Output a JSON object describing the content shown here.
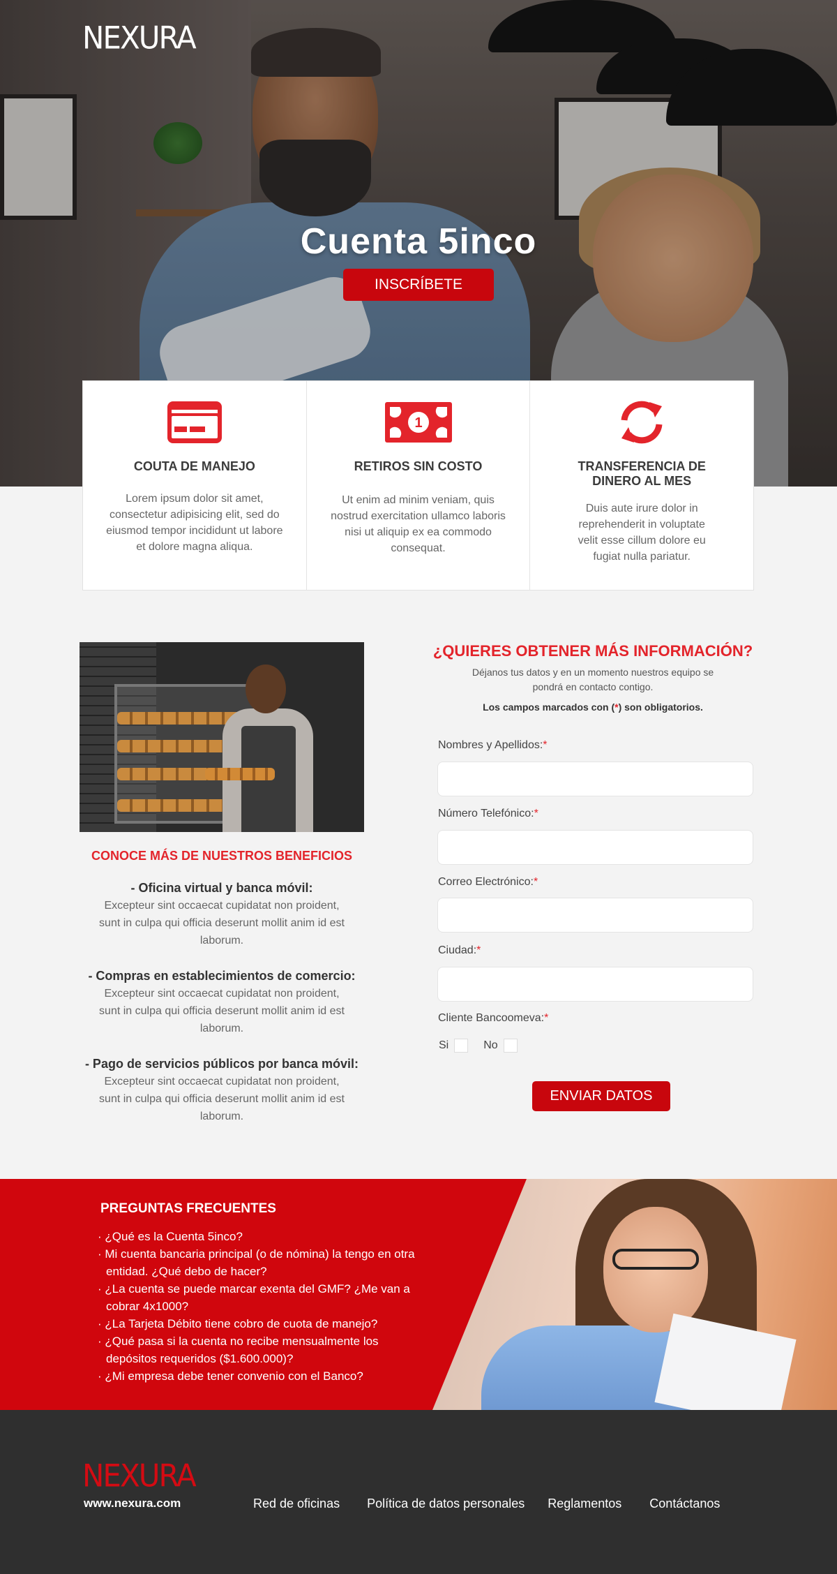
{
  "brand": {
    "logo_text": "NEXURA",
    "url_text": "www.nexura.com"
  },
  "hero": {
    "title": "Cuenta 5inco",
    "cta_label": "INSCRÍBETE"
  },
  "features": [
    {
      "icon": "credit-card-icon",
      "title": "COUTA DE MANEJO",
      "text": "Lorem ipsum dolor sit amet, consectetur adipisicing elit, sed do eiusmod tempor incididunt ut labore et dolore magna aliqua."
    },
    {
      "icon": "banknote-icon",
      "title": "RETIROS SIN COSTO",
      "text": "Ut enim ad minim veniam, quis nostrud exercitation ullamco laboris nisi ut aliquip ex ea commodo consequat."
    },
    {
      "icon": "refresh-icon",
      "title_line1": "TRANSFERENCIA DE",
      "title_line2": "DINERO AL MES",
      "text": "Duis aute irure dolor in reprehenderit in voluptate velit esse cillum dolore eu fugiat nulla pariatur."
    }
  ],
  "benefits": {
    "title": "CONOCE MÁS DE NUESTROS BENEFICIOS",
    "items": [
      {
        "heading": "- Oficina virtual y banca móvil:",
        "text": "Excepteur sint occaecat cupidatat non proident, sunt in culpa qui officia deserunt mollit anim id est laborum."
      },
      {
        "heading": "- Compras en establecimientos de comercio:",
        "text": "Excepteur sint occaecat cupidatat non proident, sunt in culpa qui officia deserunt mollit anim id est laborum."
      },
      {
        "heading": "- Pago de servicios públicos por banca móvil:",
        "text": "Excepteur sint occaecat cupidatat non proident, sunt in culpa qui officia deserunt mollit anim id est laborum."
      }
    ]
  },
  "form": {
    "title": "¿QUIERES OBTENER MÁS INFORMACIÓN?",
    "subtitle": "Déjanos tus datos y en un momento nuestros equipo se pondrá en contacto contigo.",
    "required_prefix": "Los campos marcados con (",
    "required_star": "*",
    "required_suffix": ") son obligatorios.",
    "fields": [
      {
        "label": "Nombres y Apellidos:",
        "value": ""
      },
      {
        "label": "Número Telefónico:",
        "value": ""
      },
      {
        "label": "Correo Electrónico:",
        "value": ""
      },
      {
        "label": "Ciudad:",
        "value": ""
      }
    ],
    "client_label": "Cliente Bancoomeva:",
    "option_yes": "Si",
    "option_no": "No",
    "submit_label": "ENVIAR DATOS"
  },
  "faq": {
    "title": "PREGUNTAS FRECUENTES",
    "items": [
      "¿Qué es la Cuenta 5inco?",
      "Mi cuenta bancaria principal (o de nómina) la tengo en otra entidad. ¿Qué debo de hacer?",
      "¿La cuenta se puede marcar exenta del GMF? ¿Me van a cobrar 4x1000?",
      "¿La Tarjeta Débito tiene cobro de cuota de manejo?",
      "¿Qué pasa si la cuenta no recibe mensualmente los depósitos requeridos ($1.600.000)?",
      "¿Mi empresa debe tener convenio con el Banco?"
    ]
  },
  "footer": {
    "links": [
      "Red de oficinas",
      "Política de datos personales",
      "Reglamentos",
      "Contáctanos"
    ]
  },
  "colors": {
    "accent": "#d0060d",
    "accent_text": "#e3242b",
    "footer_bg": "#2f2f2f",
    "page_bg": "#f3f3f3"
  }
}
